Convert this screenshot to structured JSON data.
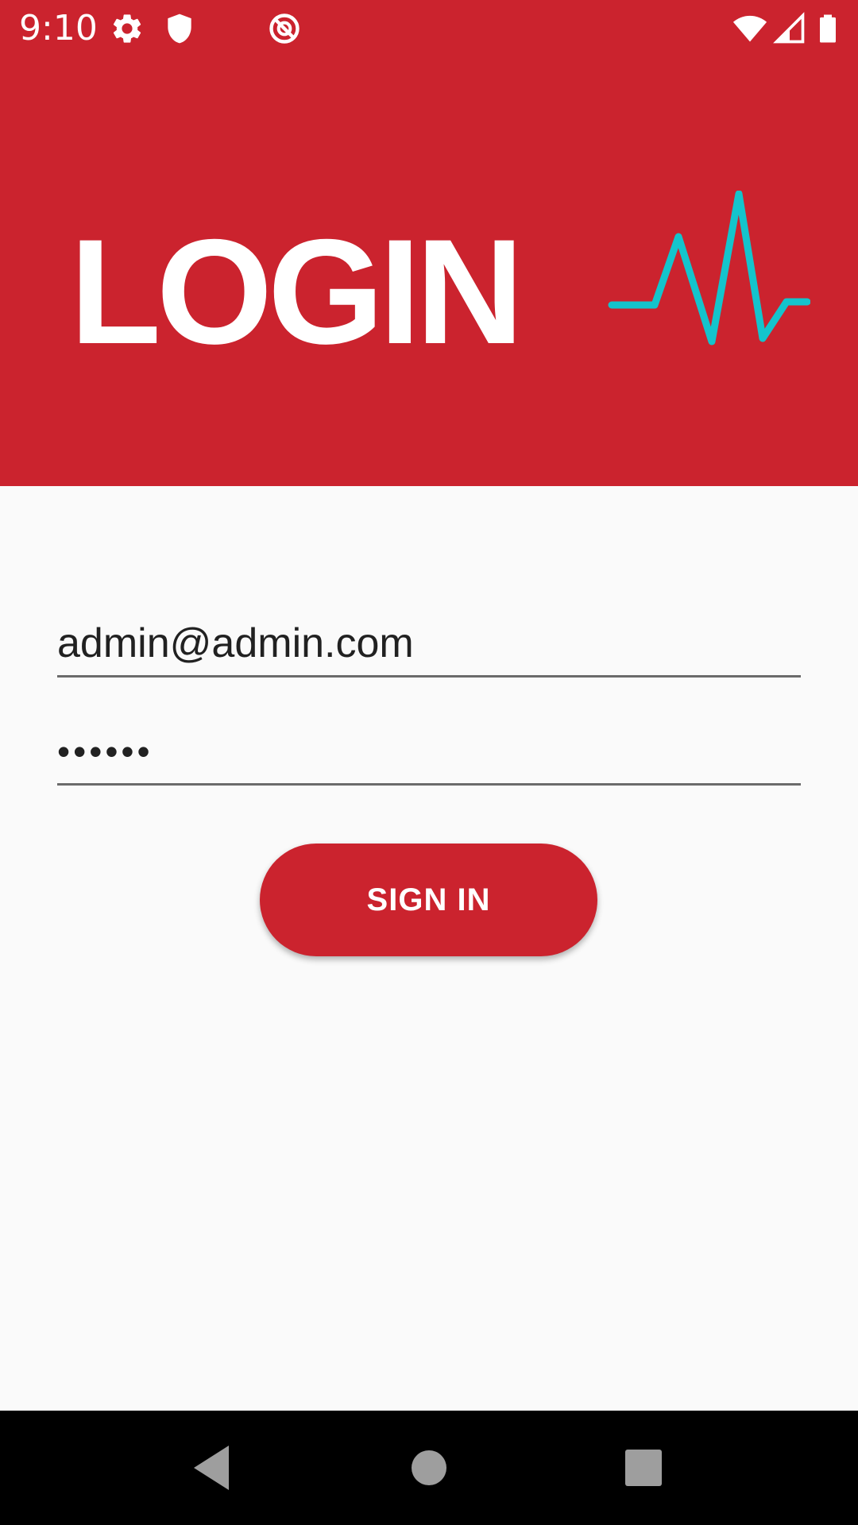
{
  "status_bar": {
    "time": "9:10",
    "icons": [
      "gear-icon",
      "shield-icon",
      "no-sync-icon",
      "wifi-icon",
      "signal-icon",
      "battery-icon"
    ]
  },
  "header": {
    "logo_text": "LOGIN",
    "logo_icon": "heartbeat-pulse-icon",
    "background_color": "#cb232e",
    "pulse_color": "#14c4cc"
  },
  "form": {
    "email_value": "admin@admin.com",
    "password_value": "••••••",
    "signin_label": "SIGN IN"
  },
  "nav_bar": {
    "buttons": [
      "back-icon",
      "home-icon",
      "recents-icon"
    ]
  }
}
